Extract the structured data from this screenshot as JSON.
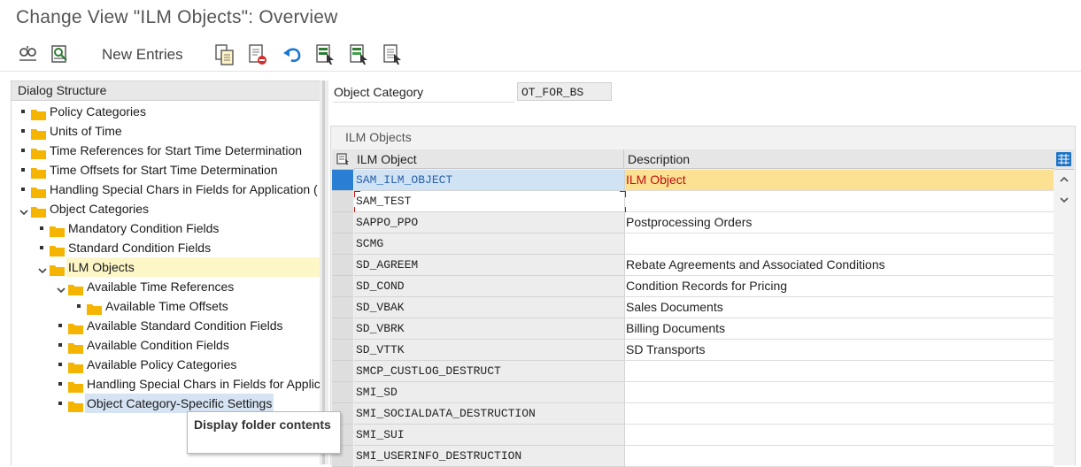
{
  "window": {
    "title": "Change View \"ILM Objects\": Overview"
  },
  "toolbar": {
    "new_entries_label": "New Entries",
    "icons": [
      "display-change-icon",
      "select-all-icon",
      "copy-icon",
      "delete-icon",
      "undo-icon",
      "select-block-icon",
      "deselect-icon",
      "print-icon"
    ]
  },
  "dialog_structure": {
    "header": "Dialog Structure",
    "items": [
      {
        "label": "Policy Categories",
        "level": 0,
        "marker": "bullet"
      },
      {
        "label": "Units of Time",
        "level": 0,
        "marker": "bullet"
      },
      {
        "label": "Time References for Start Time Determination",
        "level": 0,
        "marker": "bullet"
      },
      {
        "label": "Time Offsets for Start Time Determination",
        "level": 0,
        "marker": "bullet"
      },
      {
        "label": "Handling Special Chars in Fields for Application (",
        "level": 0,
        "marker": "bullet"
      },
      {
        "label": "Object Categories",
        "level": 0,
        "marker": "expanded"
      },
      {
        "label": "Mandatory Condition Fields",
        "level": 1,
        "marker": "bullet"
      },
      {
        "label": "Standard Condition Fields",
        "level": 1,
        "marker": "bullet"
      },
      {
        "label": "ILM Objects",
        "level": 1,
        "marker": "expanded",
        "state": "current"
      },
      {
        "label": "Available Time References",
        "level": 2,
        "marker": "expanded"
      },
      {
        "label": "Available Time Offsets",
        "level": 3,
        "marker": "bullet"
      },
      {
        "label": "Available Standard Condition Fields",
        "level": 2,
        "marker": "bullet"
      },
      {
        "label": "Available Condition Fields",
        "level": 2,
        "marker": "bullet"
      },
      {
        "label": "Available Policy Categories",
        "level": 2,
        "marker": "bullet"
      },
      {
        "label": "Handling Special Chars in Fields for Applic",
        "level": 2,
        "marker": "bullet"
      },
      {
        "label": "Object Category-Specific Settings",
        "level": 2,
        "marker": "bullet",
        "state": "hover"
      }
    ]
  },
  "tooltip": {
    "text": "Display folder contents"
  },
  "object_category": {
    "label": "Object Category",
    "value": "OT_FOR_BS"
  },
  "table": {
    "title": "ILM Objects",
    "columns": [
      "ILM Object",
      "Description"
    ],
    "rows": [
      {
        "object": "SAM_ILM_OBJECT",
        "description": "ILM Object",
        "state": "selected"
      },
      {
        "object": "SAM_TEST",
        "description": "",
        "state": "editing"
      },
      {
        "object": "SAPPO_PPO",
        "description": "Postprocessing Orders"
      },
      {
        "object": "SCMG",
        "description": ""
      },
      {
        "object": "SD_AGREEM",
        "description": "Rebate Agreements and Associated Conditions"
      },
      {
        "object": "SD_COND",
        "description": "Condition Records for Pricing"
      },
      {
        "object": "SD_VBAK",
        "description": "Sales Documents"
      },
      {
        "object": "SD_VBRK",
        "description": "Billing Documents"
      },
      {
        "object": "SD_VTTK",
        "description": "SD Transports"
      },
      {
        "object": "SMCP_CUSTLOG_DESTRUCT",
        "description": ""
      },
      {
        "object": "SMI_SD",
        "description": ""
      },
      {
        "object": "SMI_SOCIALDATA_DESTRUCTION",
        "description": ""
      },
      {
        "object": "SMI_SUI",
        "description": ""
      },
      {
        "object": "SMI_USERINFO_DESTRUCTION",
        "description": ""
      }
    ]
  },
  "colors": {
    "folder": "#f4b400",
    "selected_marker": "#2a7fd4",
    "selected_description_bg": "#fde193",
    "selected_description_text": "#c01010"
  }
}
